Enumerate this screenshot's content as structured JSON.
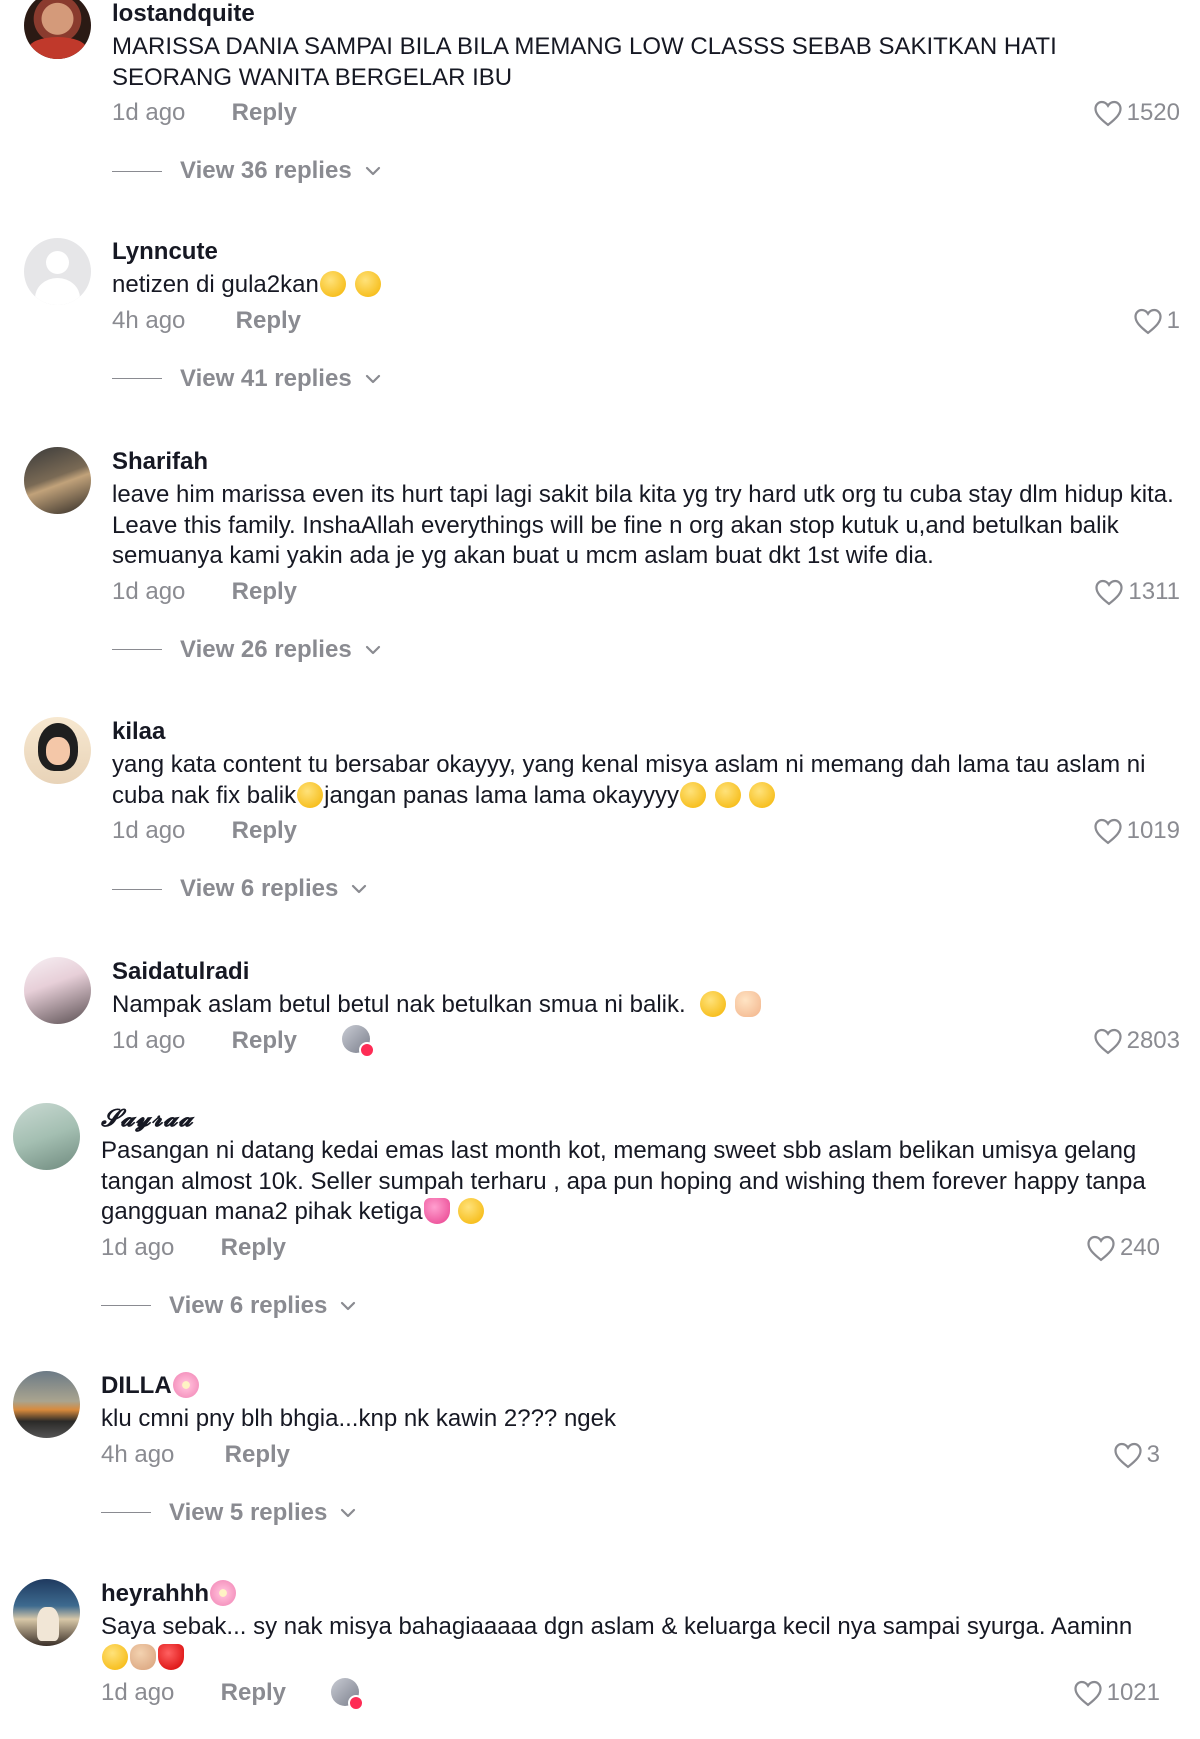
{
  "comments": [
    {
      "username": "lostandquite",
      "text": "MARISSA DANIA SAMPAI BILA BILA MEMANG LOW CLASSS SEBAB SAKITKAN HATI SEORANG WANITA BERGELAR IBU",
      "time": "1d ago",
      "reply": "Reply",
      "likes": "1520",
      "view_replies": "View 36 replies"
    },
    {
      "username": "Lynncute",
      "text": "netizen di gula2kan",
      "time": "4h ago",
      "reply": "Reply",
      "likes": "1",
      "view_replies": "View 41 replies"
    },
    {
      "username": "Sharifah",
      "text": "leave him marissa even its hurt tapi lagi sakit bila kita yg try hard utk org tu cuba stay dlm hidup kita. Leave this family. InshaAllah everythings will be fine n org akan stop kutuk u,and betulkan balik semuanya kami yakin ada je yg akan buat u mcm aslam buat dkt 1st wife dia.",
      "time": "1d ago",
      "reply": "Reply",
      "likes": "1311",
      "view_replies": "View 26 replies"
    },
    {
      "username": "kilaa",
      "text_a": "yang kata content tu bersabar okayyy, yang kenal misya aslam ni memang dah lama tau aslam ni cuba nak fix balik",
      "text_b": "jangan panas lama lama okayyyy",
      "time": "1d ago",
      "reply": "Reply",
      "likes": "1019",
      "view_replies": "View 6 replies"
    },
    {
      "username": "Saidatulradi",
      "text": "Nampak aslam betul betul nak betulkan smua ni balik.",
      "time": "1d ago",
      "reply": "Reply",
      "likes": "2803"
    },
    {
      "username": "𝓢𝓪𝔂𝓻𝓪𝓪",
      "text": "Pasangan ni datang kedai emas last month kot, memang sweet sbb aslam belikan umisya gelang tangan almost 10k. Seller sumpah terharu , apa pun hoping and wishing them forever happy tanpa gangguan mana2 pihak ketiga",
      "time": "1d ago",
      "reply": "Reply",
      "likes": "240",
      "view_replies": "View 6 replies"
    },
    {
      "username": "DILLA",
      "text": "klu cmni pny blh bhgia...knp nk kawin 2??? ngek",
      "time": "4h ago",
      "reply": "Reply",
      "likes": "3",
      "view_replies": "View 5 replies"
    },
    {
      "username": "heyrahhh",
      "text": "Saya sebak... sy nak misya bahagiaaaaa dgn aslam & keluarga kecil nya sampai syurga. Aaminn",
      "time": "1d ago",
      "reply": "Reply",
      "likes": "1021"
    }
  ],
  "colors": {
    "text": "#161823",
    "muted": "#8a8b91",
    "badge": "#fe2c55"
  },
  "icons": {
    "like": "heart-outline-icon",
    "expand": "chevron-down-icon"
  }
}
